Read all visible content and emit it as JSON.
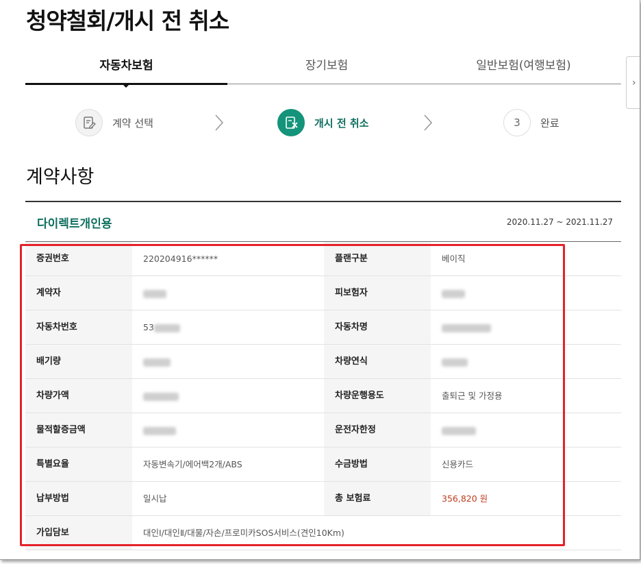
{
  "page": {
    "title": "청약철회/개시 전 취소"
  },
  "tabs": [
    {
      "label": "자동차보험",
      "active": true
    },
    {
      "label": "장기보험",
      "active": false
    },
    {
      "label": "일반보험(여행보험)",
      "active": false
    }
  ],
  "steps": [
    {
      "label": "계약 선택",
      "icon": "document-edit-icon",
      "active": false
    },
    {
      "label": "개시 전 취소",
      "icon": "document-cancel-icon",
      "active": true
    },
    {
      "number": "3",
      "label": "완료",
      "active": false
    }
  ],
  "section": {
    "title": "계약사항",
    "product_name": "다이렉트개인용",
    "period": "2020.11.27 ~ 2021.11.27"
  },
  "table": {
    "rows": [
      {
        "label1": "증권번호",
        "value1": "220204916******",
        "label2": "플랜구분",
        "value2": "베이직"
      },
      {
        "label1": "계약자",
        "value1": "",
        "label2": "피보험자",
        "value2": ""
      },
      {
        "label1": "자동차번호",
        "value1": "53",
        "label2": "자동차명",
        "value2": ""
      },
      {
        "label1": "배기량",
        "value1": "",
        "label2": "차량연식",
        "value2": ""
      },
      {
        "label1": "차량가액",
        "value1": "",
        "label2": "차량운행용도",
        "value2": "출퇴근 및 가정용"
      },
      {
        "label1": "물적할증금액",
        "value1": "",
        "label2": "운전자한정",
        "value2": ""
      },
      {
        "label1": "특별요율",
        "value1": "자동변속기/에어백2개/ABS",
        "label2": "수금방법",
        "value2": "신용카드"
      },
      {
        "label1": "납부방법",
        "value1": "일시납",
        "label2": "총 보험료",
        "value2": "356,820 원"
      }
    ],
    "coverage_label": "가입담보",
    "coverage_value": "대인Ⅰ/대인Ⅱ/대물/자손/프로미카SOS서비스(견인10Km)"
  },
  "colors": {
    "accent_green": "#14947a",
    "text_green": "#0f6f5f",
    "highlight_red": "#e5202a",
    "price_red": "#c0391a"
  }
}
